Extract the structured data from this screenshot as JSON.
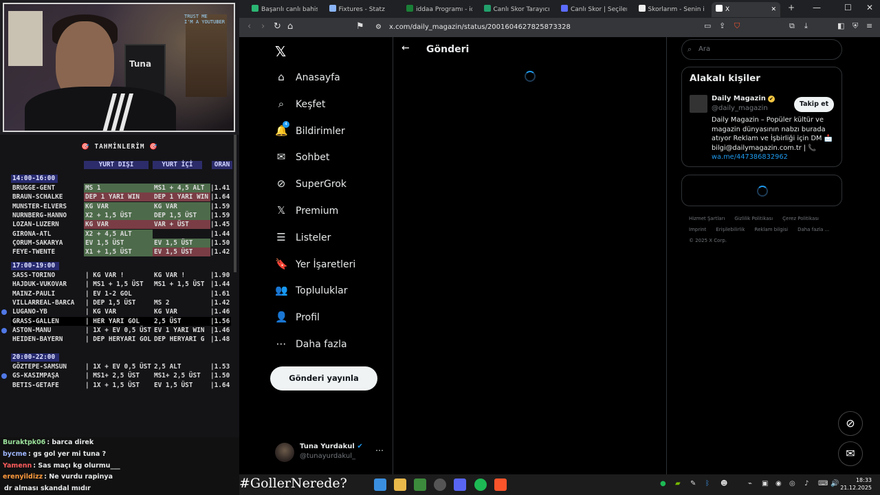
{
  "stream": {
    "cam_tags": [
      "TRUST ME",
      "I'M A YOUTUBER"
    ],
    "cam_shirt": "Tuna",
    "board_title": "🎯 TAHMİNLERİM 🎯",
    "headers": {
      "a": "YURT DIŞI",
      "b": "YURT İÇİ",
      "o": "ORAN"
    },
    "groups": [
      {
        "time": "14:00-16:00",
        "rows": [
          {
            "team": "BRUGGE-GENT",
            "a": "MS 1",
            "b": "MS1 + 4,5 ALT",
            "o": "|1.41",
            "ca": "g",
            "cb": "g",
            "dot": false,
            "sel": false
          },
          {
            "team": "BRAUN-SCHALKE",
            "a": "DEP 1 YARI WIN",
            "b": "DEP 1 YARI WIN",
            "o": "|1.64",
            "ca": "r",
            "cb": "r",
            "dot": false,
            "sel": false
          },
          {
            "team": "MUNSTER-ELVERS",
            "a": "KG VAR",
            "b": "KG VAR",
            "o": "|1.59",
            "ca": "g",
            "cb": "g",
            "dot": false,
            "sel": false
          },
          {
            "team": "NURNBERG-HANNO",
            "a": "X2 + 1,5 ÜST",
            "b": "DEP 1,5 ÜST",
            "o": "|1.59",
            "ca": "g",
            "cb": "g",
            "dot": false,
            "sel": false
          },
          {
            "team": "LOZAN-LUZERN",
            "a": "KG VAR",
            "b": "VAR + ÜST",
            "o": "|1.45",
            "ca": "r",
            "cb": "r",
            "dot": false,
            "sel": false
          },
          {
            "team": "GIRONA-ATL",
            "a": "X2 + 4,5 ALT",
            "b": "",
            "o": "|1.44",
            "ca": "g",
            "cb": "g",
            "dot": false,
            "sel": false
          },
          {
            "team": "ÇORUM-SAKARYA",
            "a": "EV 1,5 ÜST",
            "b": "EV 1,5 ÜST",
            "o": "|1.50",
            "ca": "g",
            "cb": "g",
            "dot": false,
            "sel": false
          },
          {
            "team": "FEYE-TWENTE",
            "a": "X1 + 1,5 ÜST",
            "b": "EV 1,5 ÜST",
            "o": "|1.42",
            "ca": "g",
            "cb": "r",
            "dot": false,
            "sel": false
          }
        ]
      },
      {
        "time": "17:00-19:00",
        "rows": [
          {
            "team": "SASS-TORINO",
            "a": "| KG VAR  !",
            "b": "KG VAR  !",
            "o": "|1.90",
            "ca": "x",
            "cb": "x",
            "dot": false,
            "sel": false
          },
          {
            "team": "HAJDUK-VUKOVAR",
            "a": "| MS1 + 1,5 ÜST",
            "b": "MS1 + 1,5 ÜST",
            "o": "|1.44",
            "ca": "x",
            "cb": "x",
            "dot": false,
            "sel": false
          },
          {
            "team": "MAINZ-PAULI",
            "a": "| EV 1-2 GOL",
            "b": "",
            "o": "|1.61",
            "ca": "x",
            "cb": "x",
            "dot": false,
            "sel": false
          },
          {
            "team": "VILLARREAL-BARCA",
            "a": "| DEP 1,5 ÜST",
            "b": "MS 2",
            "o": "|1.42",
            "ca": "x",
            "cb": "x",
            "dot": false,
            "sel": false
          },
          {
            "team": "LUGANO-YB",
            "a": "| KG VAR",
            "b": "KG VAR",
            "o": "|1.46",
            "ca": "x",
            "cb": "x",
            "dot": true,
            "sel": false
          },
          {
            "team": "GRASS-GALLEN",
            "a": "| HER YARI GOL",
            "b": "2,5 ÜST",
            "o": "|1.56",
            "ca": "x",
            "cb": "x",
            "dot": false,
            "sel": true
          },
          {
            "team": "ASTON-MANU",
            "a": "| 1X + EV 0,5 ÜST",
            "b": "EV 1 YARI WIN",
            "o": "|1.46",
            "ca": "x",
            "cb": "x",
            "dot": true,
            "sel": false
          },
          {
            "team": "HEIDEN-BAYERN",
            "a": "| DEP HERYARI GOL",
            "b": "DEP HERYARI G",
            "o": "|1.48",
            "ca": "x",
            "cb": "x",
            "dot": false,
            "sel": false
          }
        ]
      },
      {
        "time": "20:00-22:00",
        "rows": [
          {
            "team": "GÖZTEPE-SAMSUN",
            "a": "| 1X + EV 0,5 ÜST",
            "b": "2,5 ALT",
            "o": "|1.53",
            "ca": "x",
            "cb": "x",
            "dot": false,
            "sel": false
          },
          {
            "team": "GS-KASIMPAŞA",
            "a": "| MS1+ 2,5 ÜST",
            "b": "MS1+ 2,5 ÜST",
            "o": "|1.50",
            "ca": "x",
            "cb": "x",
            "dot": true,
            "sel": false
          },
          {
            "team": "BETIS-GETAFE",
            "a": "| 1X + 1,5 ÜST",
            "b": "EV 1,5 ÜST",
            "o": "|1.64",
            "ca": "x",
            "cb": "x",
            "dot": false,
            "sel": false
          }
        ]
      }
    ],
    "chat": [
      {
        "user": "Buraktpk06",
        "text": ": barca direk",
        "color": "#9be29b"
      },
      {
        "user": "bycme",
        "text": ": gs gol yer mi tuna ?",
        "color": "#9fb8ff"
      },
      {
        "user": "Yamenn",
        "text": ": Sas maçı kg olurmu___",
        "color": "#ff5c5c"
      },
      {
        "user": "erenyildizz",
        "text": ": Ne vurdu rapinya",
        "color": "#ff9a3c"
      },
      {
        "user": "",
        "text": "dr alması skandal mıdır",
        "color": "#ffffff"
      }
    ]
  },
  "browser": {
    "tabs": [
      {
        "label": "Başarılı canlı bahisler iç",
        "color": "#2bb673"
      },
      {
        "label": "Fixtures - Statz",
        "color": "#8ab4f8"
      },
      {
        "label": "iddaa Programı - idda",
        "color": "#1a7f37"
      },
      {
        "label": "Canlı Skor Tarayıcısı ve",
        "color": "#22a06b"
      },
      {
        "label": "Canlı Skor | Seçilen ma",
        "color": "#5b6cff"
      },
      {
        "label": "Skorlarım - Senin için",
        "color": "#eeeeee"
      },
      {
        "label": "X",
        "color": "#ffffff"
      }
    ],
    "url": "x.com/daily_magazin/status/2001604627825873328"
  },
  "x": {
    "logo": "𝕏",
    "nav": [
      {
        "icon": "⌂",
        "label": "Anasayfa"
      },
      {
        "icon": "⌕",
        "label": "Keşfet"
      },
      {
        "icon": "🔔",
        "label": "Bildirimler"
      },
      {
        "icon": "✉",
        "label": "Sohbet"
      },
      {
        "icon": "⊘",
        "label": "SuperGrok"
      },
      {
        "icon": "𝕏",
        "label": "Premium"
      },
      {
        "icon": "☰",
        "label": "Listeler"
      },
      {
        "icon": "🔖",
        "label": "Yer İşaretleri"
      },
      {
        "icon": "👥",
        "label": "Topluluklar"
      },
      {
        "icon": "👤",
        "label": "Profil"
      },
      {
        "icon": "⋯",
        "label": "Daha fazla"
      }
    ],
    "notif_count": "4",
    "post_button": "Gönderi yayınla",
    "account": {
      "name": "Tuna Yurdakul",
      "handle": "@tunayurdakul_"
    },
    "main_title": "Gönderi",
    "search_placeholder": "Ara",
    "related": {
      "title": "Alakalı kişiler",
      "name": "Daily Magazin",
      "handle": "@daily_magazin",
      "follow": "Takip et",
      "bio": "Daily Magazin – Popüler kültür ve magazin dünyasının nabzı burada atıyor Reklam ve İşbirliği için DM 📩 bilgi@dailymagazin.com.tr | 📞",
      "link": "wa.me/447386832962"
    },
    "footer": [
      "Hizmet Şartları",
      "Gizlilik Politikası",
      "Çerez Politikası",
      "Imprint",
      "Erişilebilirlik",
      "Reklam bilgisi",
      "Daha fazla ...",
      "© 2025 X Corp."
    ]
  },
  "taskbar": {
    "hashtag": "#GollerNerede?",
    "time": "18:33",
    "date": "21.12.2025"
  }
}
